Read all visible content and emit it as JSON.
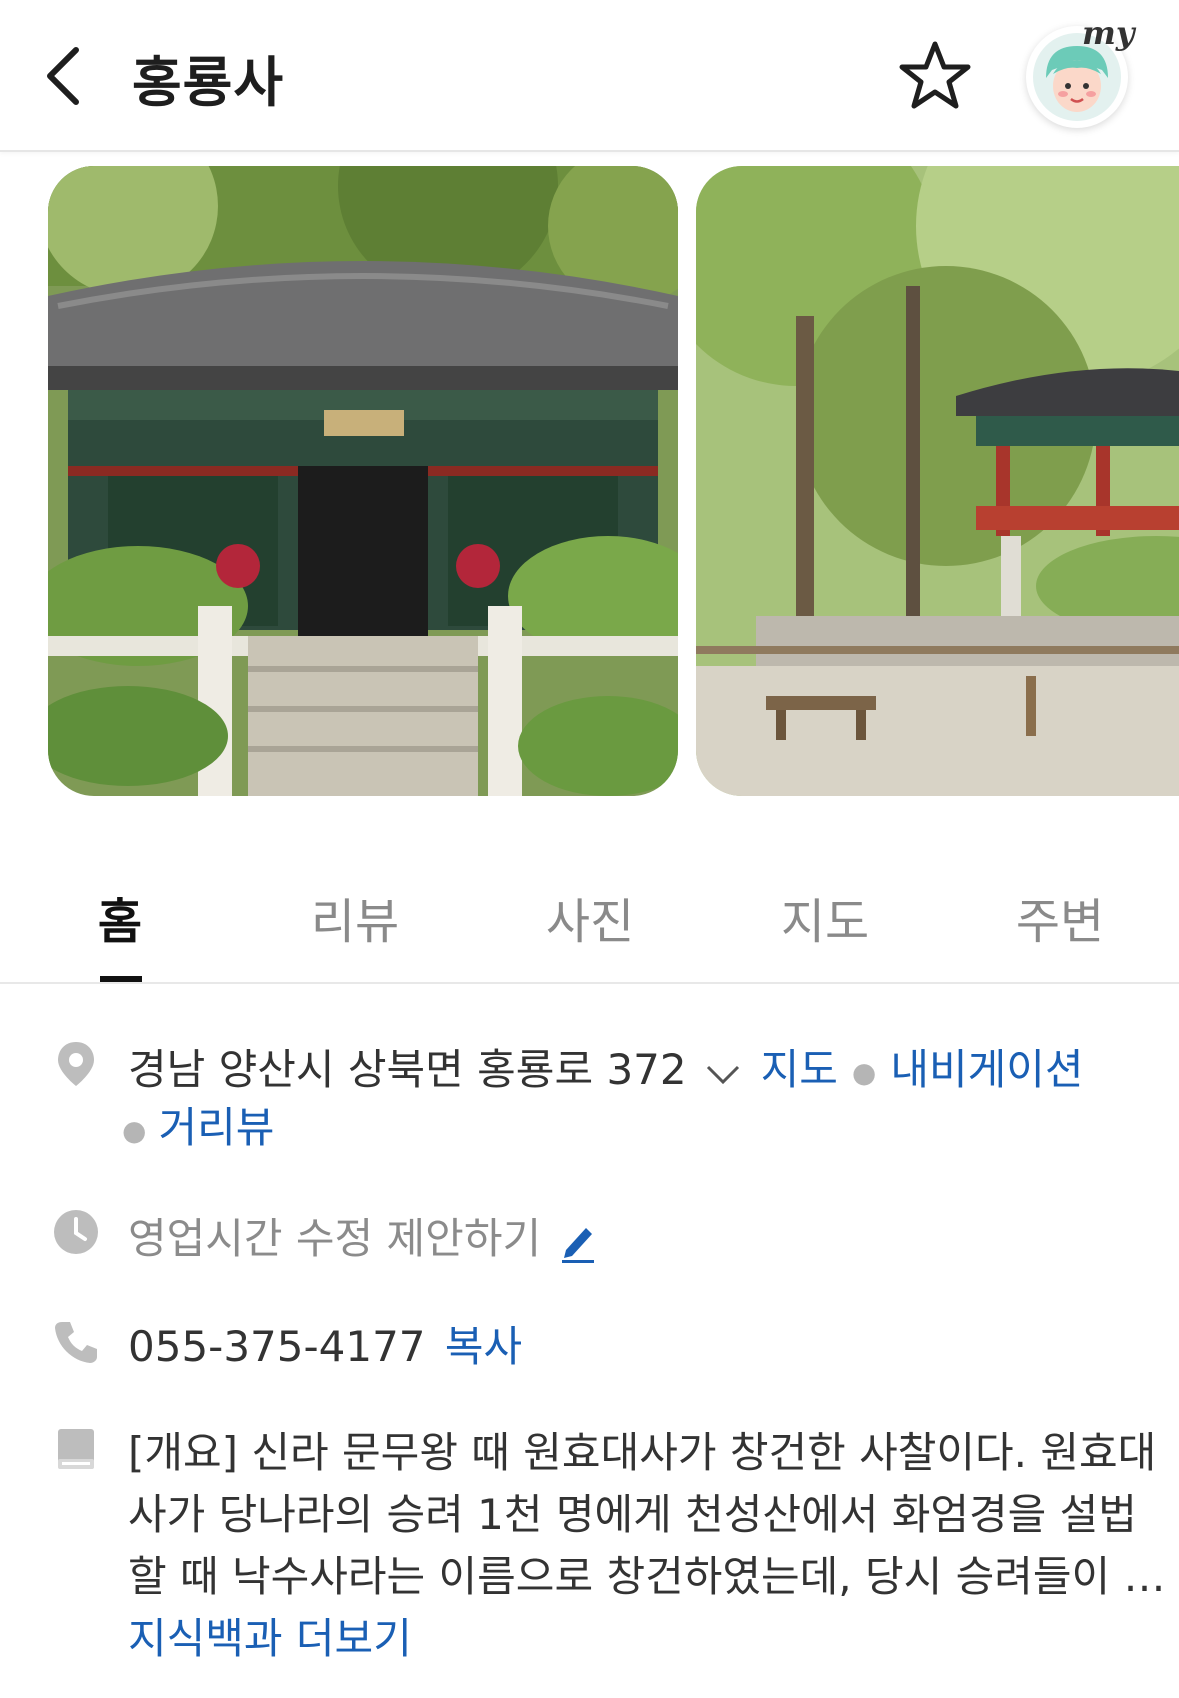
{
  "header": {
    "title": "홍룡사",
    "back_icon": "chevron-left-icon",
    "favorite_icon": "star-outline-icon",
    "avatar_badge": "my"
  },
  "photos": [
    {
      "name": "temple-main-hall-photo"
    },
    {
      "name": "temple-pavilion-forest-photo"
    }
  ],
  "tabs": [
    {
      "label": "홈",
      "active": true
    },
    {
      "label": "리뷰",
      "active": false
    },
    {
      "label": "사진",
      "active": false
    },
    {
      "label": "지도",
      "active": false
    },
    {
      "label": "주변",
      "active": false
    }
  ],
  "address": {
    "icon": "location-pin-icon",
    "text": "경남 양산시 상북면 홍룡로 372",
    "map_link": "지도",
    "navigation_link": "내비게이션",
    "streetview_link": "거리뷰"
  },
  "hours": {
    "icon": "clock-icon",
    "text": "영업시간 수정 제안하기"
  },
  "phone": {
    "icon": "phone-icon",
    "number": "055-375-4177",
    "copy_label": "복사"
  },
  "description": {
    "icon": "book-icon",
    "lines": [
      "[개요] 신라 문무왕 때 원효대사가 창건한 사찰이다. 원효대",
      "사가 당나라의 승려 1천 명에게 천성산에서 화엄경을 설법",
      "할 때 낙수사라는 이름으로 창건하였는데, 당시 승려들이 …"
    ],
    "more_link": "지식백과 더보기"
  },
  "colors": {
    "link": "#1a5fb4",
    "active_tab": "#111111",
    "inactive_tab": "#8a8a8a",
    "icon_gray": "#bdbdbd"
  }
}
